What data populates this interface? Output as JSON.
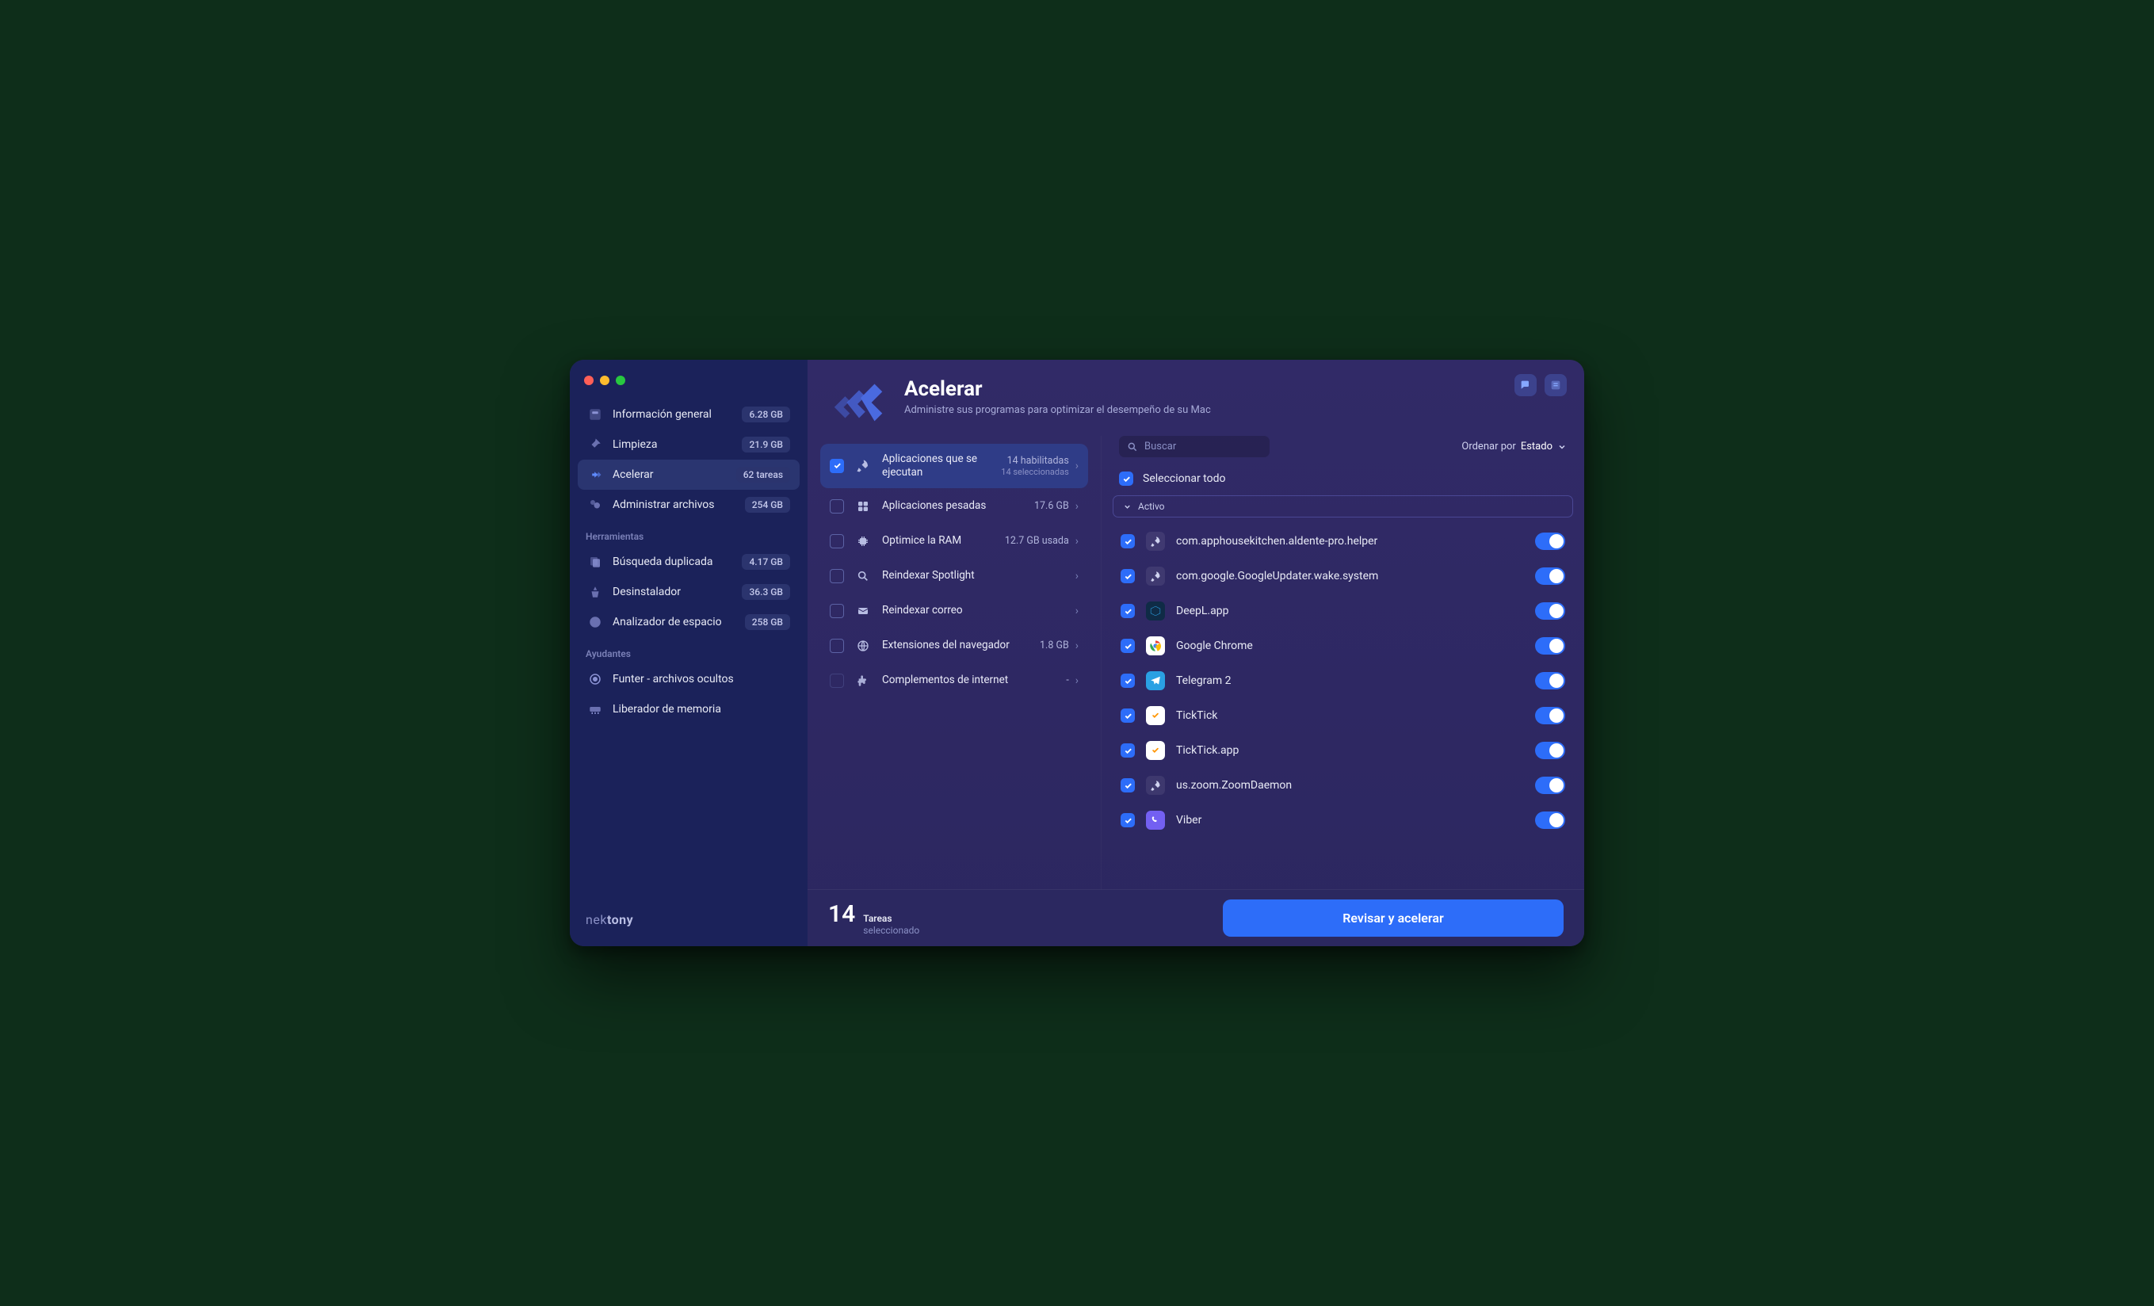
{
  "brand": {
    "prefix": "nek",
    "suffix": "tony"
  },
  "sidebar": {
    "items": [
      {
        "label": "Información general",
        "badge": "6.28 GB"
      },
      {
        "label": "Limpieza",
        "badge": "21.9 GB"
      },
      {
        "label": "Acelerar",
        "badge": "62 tareas"
      },
      {
        "label": "Administrar archivos",
        "badge": "254 GB"
      }
    ],
    "section_tools": "Herramientas",
    "tools": [
      {
        "label": "Búsqueda duplicada",
        "badge": "4.17 GB"
      },
      {
        "label": "Desinstalador",
        "badge": "36.3 GB"
      },
      {
        "label": "Analizador de espacio",
        "badge": "258 GB"
      }
    ],
    "section_helpers": "Ayudantes",
    "helpers": [
      {
        "label": "Funter - archivos ocultos"
      },
      {
        "label": "Liberador de memoria"
      }
    ]
  },
  "header": {
    "title": "Acelerar",
    "subtitle": "Administre sus programas para optimizar el desempeño de su Mac"
  },
  "categories": [
    {
      "name": "Aplicaciones que se ejecutan",
      "right": "14 habilitadas",
      "right_sub": "14 seleccionadas",
      "checked": true,
      "active": true
    },
    {
      "name": "Aplicaciones pesadas",
      "right": "17.6 GB",
      "checked": false
    },
    {
      "name": "Optimice la RAM",
      "right": "12.7 GB usada",
      "checked": false
    },
    {
      "name": "Reindexar Spotlight",
      "right": "",
      "checked": false
    },
    {
      "name": "Reindexar correo",
      "right": "",
      "checked": false
    },
    {
      "name": "Extensiones del navegador",
      "right": "1.8 GB",
      "checked": false
    },
    {
      "name": "Complementos de internet",
      "right": "-",
      "checked": false
    }
  ],
  "detail": {
    "search_placeholder": "Buscar",
    "sort_prefix": "Ordenar por ",
    "sort_value": "Estado",
    "select_all": "Seleccionar todo",
    "group_label": "Activo",
    "items": [
      {
        "name": "com.apphousekitchen.aldente-pro.helper",
        "icon": "rocket",
        "bg": "",
        "checked": true
      },
      {
        "name": "com.google.GoogleUpdater.wake.system",
        "icon": "rocket",
        "bg": "",
        "checked": true
      },
      {
        "name": "DeepL.app",
        "icon": "deepl",
        "bg": "#0f2b46",
        "checked": true
      },
      {
        "name": "Google Chrome",
        "icon": "chrome",
        "bg": "#fff",
        "checked": true
      },
      {
        "name": "Telegram 2",
        "icon": "telegram",
        "bg": "#2aa0e3",
        "checked": true
      },
      {
        "name": "TickTick",
        "icon": "ticktick",
        "bg": "#fff",
        "checked": true
      },
      {
        "name": "TickTick.app",
        "icon": "ticktick",
        "bg": "#fff",
        "checked": true
      },
      {
        "name": "us.zoom.ZoomDaemon",
        "icon": "rocket",
        "bg": "",
        "checked": true
      },
      {
        "name": "Viber",
        "icon": "viber",
        "bg": "#7360f2",
        "checked": true
      }
    ]
  },
  "footer": {
    "count": "14",
    "label_top": "Tareas",
    "label_bottom": "seleccionado",
    "cta": "Revisar y acelerar"
  }
}
